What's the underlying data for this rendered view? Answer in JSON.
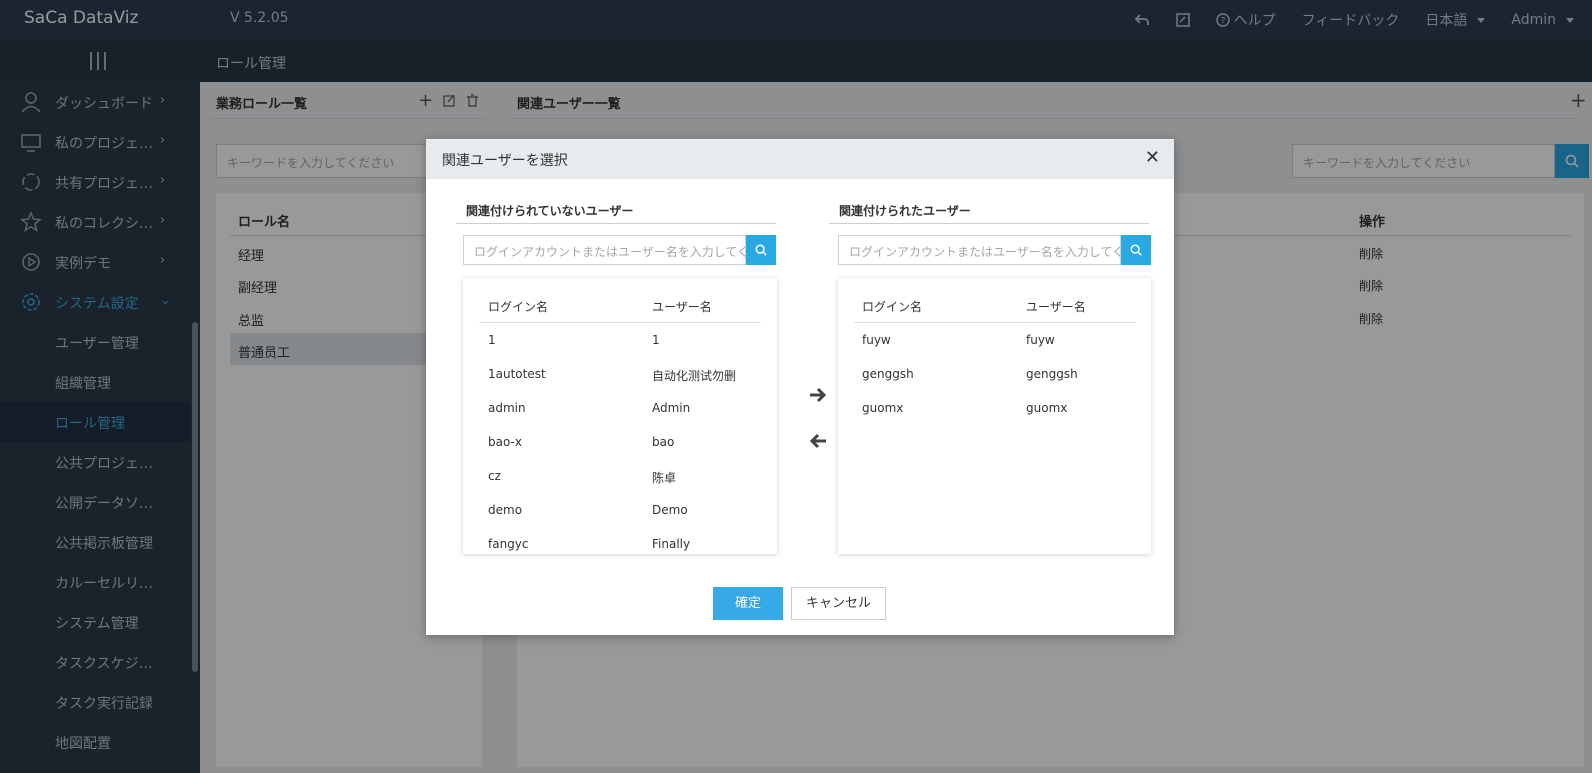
{
  "app": {
    "logo": "SaCa DataViz",
    "version": "V 5.2.05"
  },
  "topbar": {
    "help": "ヘルプ",
    "feedback": "フィードバック",
    "language": "日本語",
    "user": "Admin"
  },
  "breadcrumb": "ロール管理",
  "sidebar": {
    "items": [
      {
        "label": "ダッシュボード",
        "icon": "user-icon"
      },
      {
        "label": "私のプロジェ…",
        "icon": "monitor-icon"
      },
      {
        "label": "共有プロジェ…",
        "icon": "share-icon"
      },
      {
        "label": "私のコレクシ…",
        "icon": "star-icon"
      },
      {
        "label": "実例デモ",
        "icon": "play-icon"
      },
      {
        "label": "システム設定",
        "icon": "gear-icon"
      }
    ],
    "subitems": [
      "ユーザー管理",
      "組織管理",
      "ロール管理",
      "公共プロジェ…",
      "公開データソ…",
      "公共掲示板管理",
      "カルーセルリ…",
      "システム管理",
      "タスクスケジ…",
      "タスク実行記録",
      "地図配置"
    ]
  },
  "left_panel": {
    "title": "業務ロール一覧",
    "search_placeholder": "キーワードを入力してください",
    "column": "ロール名",
    "rows": [
      "经理",
      "副经理",
      "总监",
      "普通员工"
    ]
  },
  "right_panel": {
    "title": "関連ユーザー一覧",
    "search_placeholder": "キーワードを入力してください",
    "action_column": "操作",
    "actions": [
      "削除",
      "削除",
      "削除"
    ]
  },
  "modal": {
    "title": "関連ユーザーを選択",
    "left_title": "関連付けられていないユーザー",
    "right_title": "関連付けられたユーザー",
    "search_placeholder": "ログインアカウントまたはユーザー名を入力してください",
    "col_login": "ログイン名",
    "col_user": "ユーザー名",
    "unassigned": [
      {
        "login": "1",
        "user": "1"
      },
      {
        "login": "1autotest",
        "user": "自动化测试勿删"
      },
      {
        "login": "admin",
        "user": "Admin"
      },
      {
        "login": "bao-x",
        "user": "bao"
      },
      {
        "login": "cz",
        "user": "陈卓"
      },
      {
        "login": "demo",
        "user": "Demo"
      },
      {
        "login": "fangyc",
        "user": "Finally"
      }
    ],
    "assigned": [
      {
        "login": "fuyw",
        "user": "fuyw"
      },
      {
        "login": "genggsh",
        "user": "genggsh"
      },
      {
        "login": "guomx",
        "user": "guomx"
      }
    ],
    "ok": "確定",
    "cancel": "キャンセル"
  }
}
